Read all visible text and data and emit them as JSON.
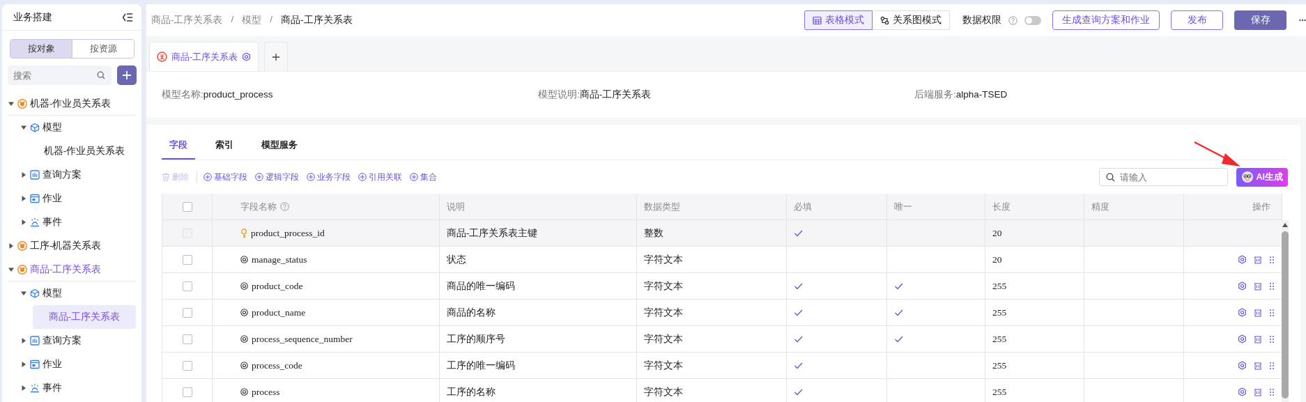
{
  "sidebar": {
    "title": "业务搭建",
    "tabs": [
      {
        "label": "按对象",
        "selected": true
      },
      {
        "label": "按资源",
        "selected": false
      }
    ],
    "search": {
      "placeholder": "搜索"
    },
    "tree": [
      {
        "kind": "object",
        "label": "机器-作业员关系表",
        "expanded": true,
        "selected": false,
        "children": [
          {
            "kind": "model",
            "label": "模型",
            "expanded": true,
            "selected": false,
            "children": [
              {
                "kind": "leaf",
                "label": "机器-作业员关系表",
                "selected": false
              }
            ]
          },
          {
            "kind": "query",
            "label": "查询方案",
            "expanded": false,
            "selected": false
          },
          {
            "kind": "job",
            "label": "作业",
            "expanded": false,
            "selected": false
          },
          {
            "kind": "event",
            "label": "事件",
            "expanded": false,
            "selected": false
          }
        ]
      },
      {
        "kind": "object",
        "label": "工序-机器关系表",
        "expanded": false,
        "selected": false
      },
      {
        "kind": "object",
        "label": "商品-工序关系表",
        "expanded": true,
        "selected": true,
        "children": [
          {
            "kind": "model",
            "label": "模型",
            "expanded": true,
            "selected": false,
            "children": [
              {
                "kind": "leaf",
                "label": "商品-工序关系表",
                "selected": true
              }
            ]
          },
          {
            "kind": "query",
            "label": "查询方案",
            "expanded": false,
            "selected": false
          },
          {
            "kind": "job",
            "label": "作业",
            "expanded": false,
            "selected": false
          },
          {
            "kind": "event",
            "label": "事件",
            "expanded": false,
            "selected": false
          }
        ]
      }
    ]
  },
  "breadcrumb": [
    {
      "kind": "link",
      "text": "商品-工序关系表"
    },
    {
      "kind": "separator",
      "text": "/"
    },
    {
      "kind": "link",
      "text": "模型"
    },
    {
      "kind": "separator",
      "text": "/"
    },
    {
      "kind": "current",
      "text": "商品-工序关系表"
    }
  ],
  "toolbar": {
    "view_modes": [
      {
        "label": "表格模式",
        "kind": "table",
        "selected": true
      },
      {
        "label": "关系图模式",
        "kind": "graph",
        "selected": false
      }
    ],
    "data_permission": {
      "label": "数据权限",
      "on": false
    },
    "buttons": [
      {
        "label": "生成查询方案和作业",
        "kind": "outline"
      },
      {
        "label": "发布",
        "kind": "outline"
      },
      {
        "label": "保存",
        "kind": "primary"
      }
    ]
  },
  "doc_tabs": [
    {
      "label": "商品-工序关系表",
      "selected": true
    }
  ],
  "model_info": [
    {
      "label": "模型名称:",
      "value": "product_process"
    },
    {
      "label": "模型说明:",
      "value": "商品-工序关系表"
    },
    {
      "label": "后端服务:",
      "value": "alpha-TSED"
    }
  ],
  "section_tabs": [
    {
      "label": "字段",
      "selected": true
    },
    {
      "label": "索引",
      "selected": false
    },
    {
      "label": "模型服务",
      "selected": false
    }
  ],
  "actions": [
    {
      "label": "删除",
      "kind": "delete",
      "disabled": true
    },
    {
      "label": "基础字段",
      "kind": "add",
      "disabled": false
    },
    {
      "label": "逻辑字段",
      "kind": "add",
      "disabled": false
    },
    {
      "label": "业务字段",
      "kind": "add",
      "disabled": false
    },
    {
      "label": "引用关联",
      "kind": "add",
      "disabled": false
    },
    {
      "label": "集合",
      "kind": "add",
      "disabled": false
    }
  ],
  "field_search": {
    "placeholder": "请输入"
  },
  "ai_button": {
    "label": "AI生成"
  },
  "table": {
    "select_all": {
      "checked": false
    },
    "columns": [
      {
        "label": "字段名称",
        "help": true
      },
      {
        "label": "说明",
        "help": false
      },
      {
        "label": "数据类型",
        "help": false
      },
      {
        "label": "必填",
        "help": false
      },
      {
        "label": "唯一",
        "help": false
      },
      {
        "label": "长度",
        "help": false
      },
      {
        "label": "精度",
        "help": false
      },
      {
        "label": "操作",
        "help": false
      }
    ],
    "rows": [
      {
        "kind": "primary",
        "checked": false,
        "disabled": true,
        "name": "product_process_id",
        "description": "商品-工序关系表主键",
        "type": "整数",
        "required": true,
        "unique": false,
        "length": "20"
      },
      {
        "kind": "field",
        "checked": false,
        "disabled": false,
        "name": "manage_status",
        "description": "状态",
        "type": "字符文本",
        "required": false,
        "unique": false,
        "length": "20"
      },
      {
        "kind": "field",
        "checked": false,
        "disabled": false,
        "name": "product_code",
        "description": "商品的唯一编码",
        "type": "字符文本",
        "required": true,
        "unique": true,
        "length": "255"
      },
      {
        "kind": "field",
        "checked": false,
        "disabled": false,
        "name": "product_name",
        "description": "商品的名称",
        "type": "字符文本",
        "required": true,
        "unique": true,
        "length": "255"
      },
      {
        "kind": "field",
        "checked": false,
        "disabled": false,
        "name": "process_sequence_number",
        "description": "工序的顺序号",
        "type": "字符文本",
        "required": true,
        "unique": true,
        "length": "255"
      },
      {
        "kind": "field",
        "checked": false,
        "disabled": false,
        "name": "process_code",
        "description": "工序的唯一编码",
        "type": "字符文本",
        "required": true,
        "unique": false,
        "length": "255"
      },
      {
        "kind": "field",
        "checked": false,
        "disabled": false,
        "name": "process",
        "description": "工序的名称",
        "type": "字符文本",
        "required": true,
        "unique": false,
        "length": "255"
      }
    ]
  }
}
